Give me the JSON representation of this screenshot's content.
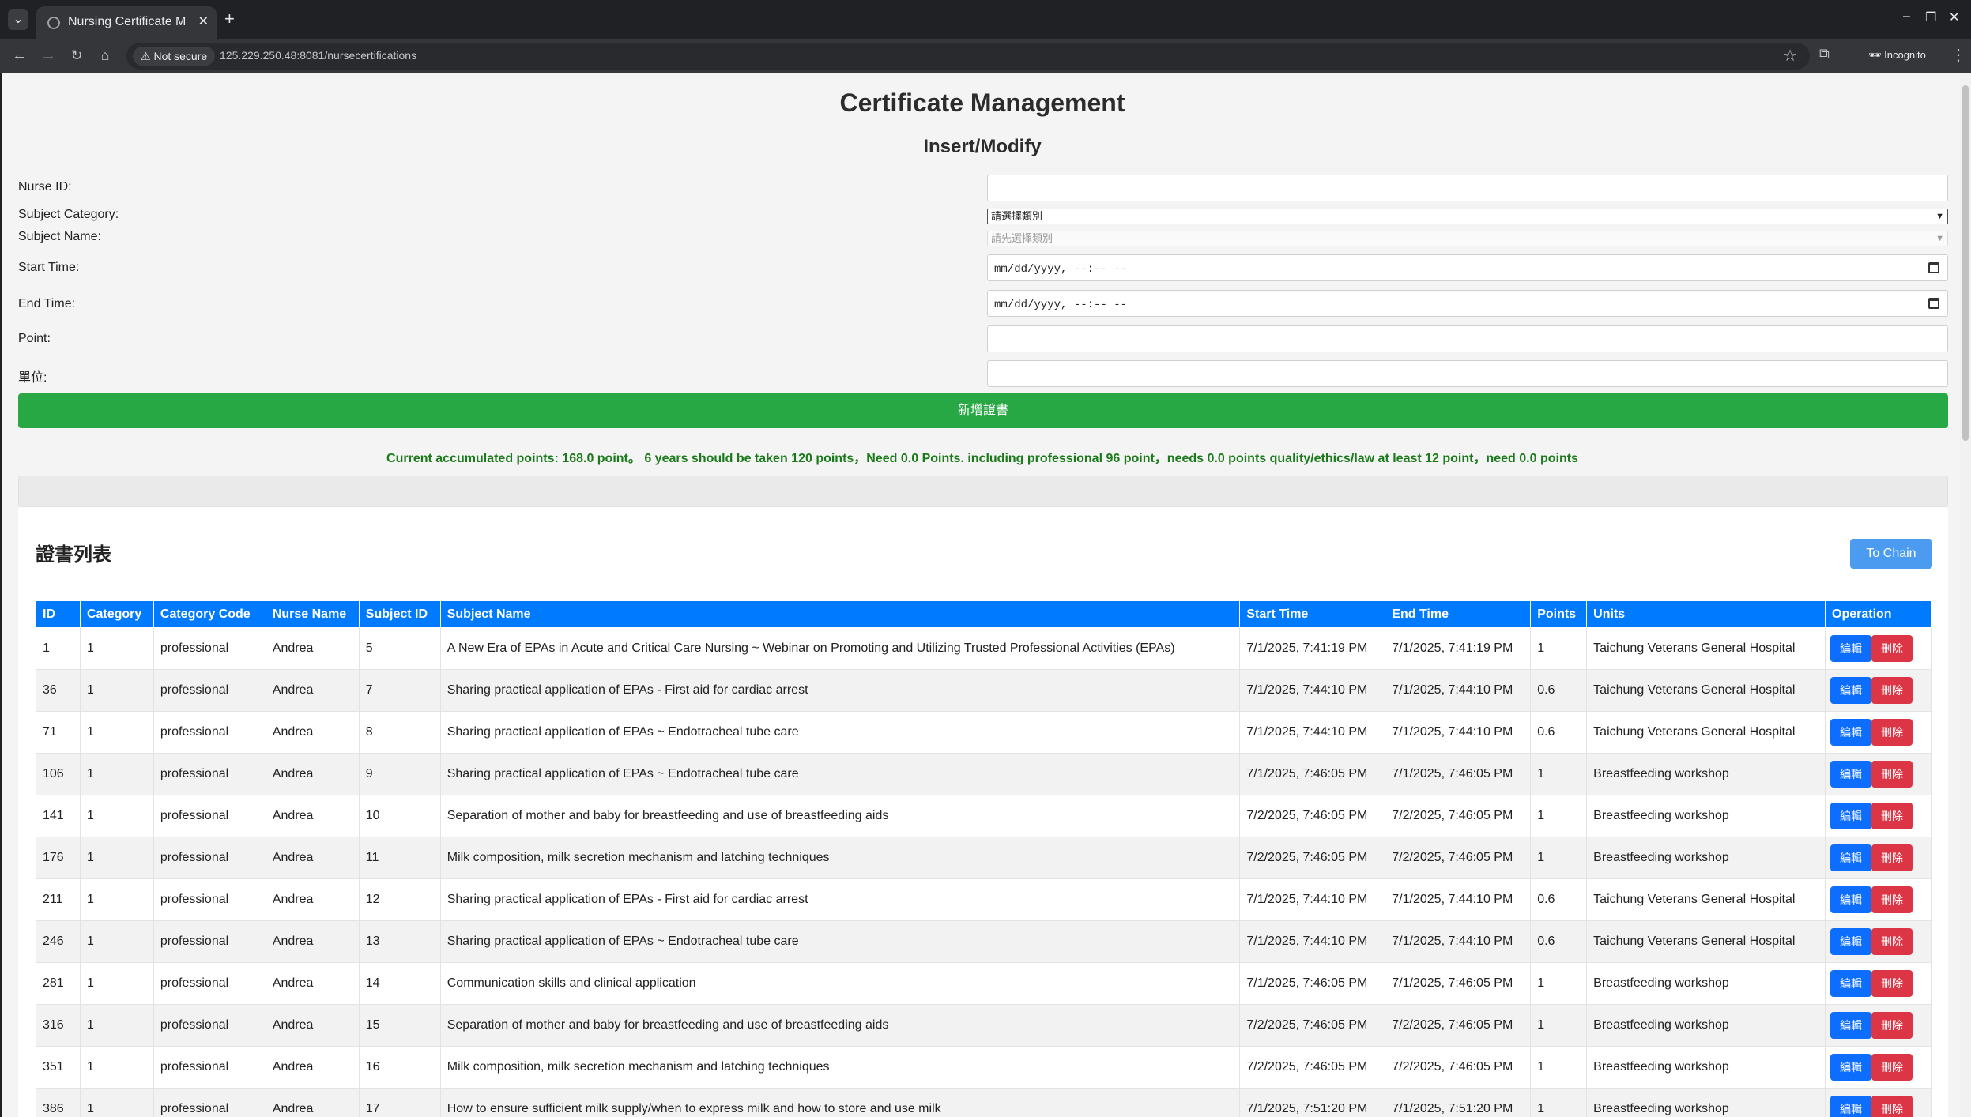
{
  "browser": {
    "tab_title": "Nursing Certificate Mana",
    "url": "125.229.250.48:8081/nursecertifications",
    "security_label": "Not secure",
    "mode_label": "Incognito"
  },
  "page": {
    "title": "Certificate Management",
    "form_title": "Insert/Modify"
  },
  "form": {
    "nurse_id_label": "Nurse ID:",
    "subject_category_label": "Subject Category:",
    "subject_category_value": "請選擇類別",
    "subject_name_label": "Subject Name:",
    "subject_name_value": "請先選擇類別",
    "start_time_label": "Start Time:",
    "start_time_placeholder": "mm/dd/yyyy, --:-- --",
    "end_time_label": "End Time:",
    "end_time_placeholder": "mm/dd/yyyy, --:-- --",
    "point_label": "Point:",
    "unit_label": "單位:",
    "submit_label": "新增證書"
  },
  "summary": {
    "points_text": "Current accumulated points: 168.0 point。 6 years should be taken 120 points，Need 0.0 Points. including professional 96 point，needs 0.0 points quality/ethics/law at least 12 point，need 0.0 points"
  },
  "list": {
    "title": "證書列表",
    "chain_button": "To Chain",
    "columns": [
      "ID",
      "Category",
      "Category Code",
      "Nurse Name",
      "Subject ID",
      "Subject Name",
      "Start Time",
      "End Time",
      "Points",
      "Units",
      "Operation"
    ],
    "edit_label": "編輯",
    "delete_label": "刪除",
    "rows": [
      {
        "id": "1",
        "category": "1",
        "category_code": "professional",
        "nurse_name": "Andrea",
        "subject_id": "5",
        "subject_name": "A New Era of EPAs in Acute and Critical Care Nursing ~ Webinar on Promoting and Utilizing Trusted Professional Activities (EPAs)",
        "start_time": "7/1/2025, 7:41:19 PM",
        "end_time": "7/1/2025, 7:41:19 PM",
        "points": "1",
        "units": "Taichung Veterans General Hospital"
      },
      {
        "id": "36",
        "category": "1",
        "category_code": "professional",
        "nurse_name": "Andrea",
        "subject_id": "7",
        "subject_name": "Sharing practical application of EPAs - First aid for cardiac arrest",
        "start_time": "7/1/2025, 7:44:10 PM",
        "end_time": "7/1/2025, 7:44:10 PM",
        "points": "0.6",
        "units": "Taichung Veterans General Hospital"
      },
      {
        "id": "71",
        "category": "1",
        "category_code": "professional",
        "nurse_name": "Andrea",
        "subject_id": "8",
        "subject_name": "Sharing practical application of EPAs ~ Endotracheal tube care",
        "start_time": "7/1/2025, 7:44:10 PM",
        "end_time": "7/1/2025, 7:44:10 PM",
        "points": "0.6",
        "units": "Taichung Veterans General Hospital"
      },
      {
        "id": "106",
        "category": "1",
        "category_code": "professional",
        "nurse_name": "Andrea",
        "subject_id": "9",
        "subject_name": "Sharing practical application of EPAs ~ Endotracheal tube care",
        "start_time": "7/1/2025, 7:46:05 PM",
        "end_time": "7/1/2025, 7:46:05 PM",
        "points": "1",
        "units": "Breastfeeding workshop"
      },
      {
        "id": "141",
        "category": "1",
        "category_code": "professional",
        "nurse_name": "Andrea",
        "subject_id": "10",
        "subject_name": "Separation of mother and baby for breastfeeding and use of breastfeeding aids",
        "start_time": "7/2/2025, 7:46:05 PM",
        "end_time": "7/2/2025, 7:46:05 PM",
        "points": "1",
        "units": "Breastfeeding workshop"
      },
      {
        "id": "176",
        "category": "1",
        "category_code": "professional",
        "nurse_name": "Andrea",
        "subject_id": "11",
        "subject_name": "Milk composition, milk secretion mechanism and latching techniques",
        "start_time": "7/2/2025, 7:46:05 PM",
        "end_time": "7/2/2025, 7:46:05 PM",
        "points": "1",
        "units": "Breastfeeding workshop"
      },
      {
        "id": "211",
        "category": "1",
        "category_code": "professional",
        "nurse_name": "Andrea",
        "subject_id": "12",
        "subject_name": "Sharing practical application of EPAs - First aid for cardiac arrest",
        "start_time": "7/1/2025, 7:44:10 PM",
        "end_time": "7/1/2025, 7:44:10 PM",
        "points": "0.6",
        "units": "Taichung Veterans General Hospital"
      },
      {
        "id": "246",
        "category": "1",
        "category_code": "professional",
        "nurse_name": "Andrea",
        "subject_id": "13",
        "subject_name": "Sharing practical application of EPAs ~ Endotracheal tube care",
        "start_time": "7/1/2025, 7:44:10 PM",
        "end_time": "7/1/2025, 7:44:10 PM",
        "points": "0.6",
        "units": "Taichung Veterans General Hospital"
      },
      {
        "id": "281",
        "category": "1",
        "category_code": "professional",
        "nurse_name": "Andrea",
        "subject_id": "14",
        "subject_name": "Communication skills and clinical application",
        "start_time": "7/1/2025, 7:46:05 PM",
        "end_time": "7/1/2025, 7:46:05 PM",
        "points": "1",
        "units": "Breastfeeding workshop"
      },
      {
        "id": "316",
        "category": "1",
        "category_code": "professional",
        "nurse_name": "Andrea",
        "subject_id": "15",
        "subject_name": "Separation of mother and baby for breastfeeding and use of breastfeeding aids",
        "start_time": "7/2/2025, 7:46:05 PM",
        "end_time": "7/2/2025, 7:46:05 PM",
        "points": "1",
        "units": "Breastfeeding workshop"
      },
      {
        "id": "351",
        "category": "1",
        "category_code": "professional",
        "nurse_name": "Andrea",
        "subject_id": "16",
        "subject_name": "Milk composition, milk secretion mechanism and latching techniques",
        "start_time": "7/2/2025, 7:46:05 PM",
        "end_time": "7/2/2025, 7:46:05 PM",
        "points": "1",
        "units": "Breastfeeding workshop"
      },
      {
        "id": "386",
        "category": "1",
        "category_code": "professional",
        "nurse_name": "Andrea",
        "subject_id": "17",
        "subject_name": "How to ensure sufficient milk supply/when to express milk and how to store and use milk",
        "start_time": "7/1/2025, 7:51:20 PM",
        "end_time": "7/1/2025, 7:51:20 PM",
        "points": "1",
        "units": "Breastfeeding workshop"
      }
    ]
  },
  "colors": {
    "header_blue": "#007bff",
    "submit_green": "#28a745",
    "delete_red": "#dc3545",
    "summary_green": "#1b7a1b"
  }
}
